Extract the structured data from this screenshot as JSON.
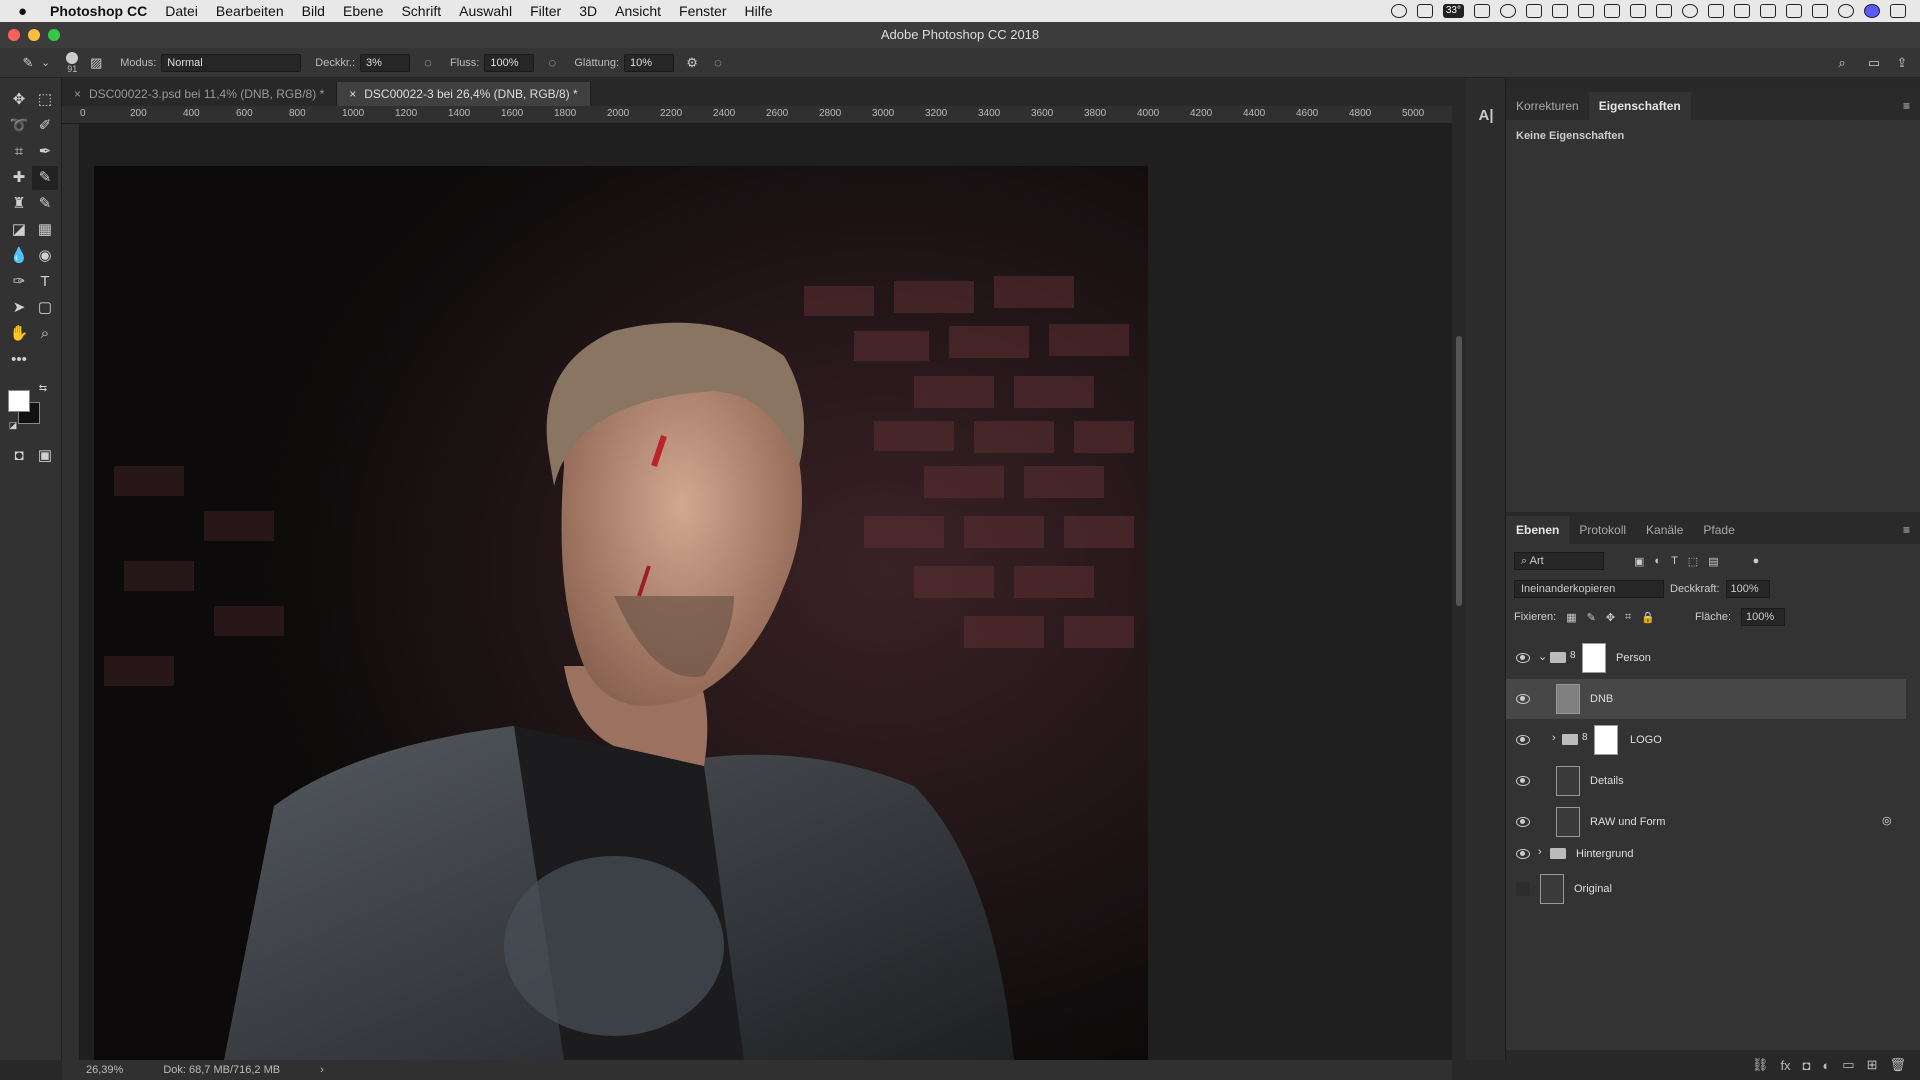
{
  "menubar": {
    "apple": "",
    "app": "Photoshop CC",
    "items": [
      "Datei",
      "Bearbeiten",
      "Bild",
      "Ebene",
      "Schrift",
      "Auswahl",
      "Filter",
      "3D",
      "Ansicht",
      "Fenster",
      "Hilfe"
    ],
    "temp_badge": "33°"
  },
  "window": {
    "title": "Adobe Photoshop CC 2018"
  },
  "options": {
    "brush_size": "91",
    "mode_label": "Modus:",
    "mode_value": "Normal",
    "opacity_label": "Deckkr.:",
    "opacity_value": "3%",
    "flow_label": "Fluss:",
    "flow_value": "100%",
    "smoothing_label": "Glättung:",
    "smoothing_value": "10%"
  },
  "tabs": [
    {
      "label": "DSC00022-3.psd bei 11,4% (DNB, RGB/8) *"
    },
    {
      "label": "DSC00022-3 bei 26,4% (DNB, RGB/8) *"
    }
  ],
  "ruler": {
    "h": [
      "0",
      "200",
      "400",
      "600",
      "800",
      "1000",
      "1200",
      "1400",
      "1600",
      "1800",
      "2000",
      "2200",
      "2400",
      "2600",
      "2800",
      "3000",
      "3200",
      "3400",
      "3600",
      "3800",
      "4000",
      "4200",
      "4400",
      "4600",
      "4800",
      "5000"
    ]
  },
  "status": {
    "zoom": "26,39%",
    "doc": "Dok: 68,7 MB/716,2 MB",
    "arrow": "›"
  },
  "props": {
    "tabs": [
      "Korrekturen",
      "Eigenschaften"
    ],
    "empty": "Keine Eigenschaften"
  },
  "layers_panel": {
    "tabs": [
      "Ebenen",
      "Protokoll",
      "Kanäle",
      "Pfade"
    ],
    "filter": "Art",
    "blend": "Ineinanderkopieren",
    "opacity_label": "Deckkraft:",
    "opacity_value": "100%",
    "lock_label": "Fixieren:",
    "fill_label": "Fläche:",
    "fill_value": "100%",
    "layers": [
      {
        "name": "Person"
      },
      {
        "name": "DNB"
      },
      {
        "name": "LOGO"
      },
      {
        "name": "Details"
      },
      {
        "name": "RAW und Form"
      },
      {
        "name": "Hintergrund"
      },
      {
        "name": "Original"
      }
    ]
  },
  "colors": {
    "accent": "#4a4a4a",
    "brick": "#5c2f33",
    "skin": "#c89a82",
    "jacket": "#3b3e42"
  }
}
